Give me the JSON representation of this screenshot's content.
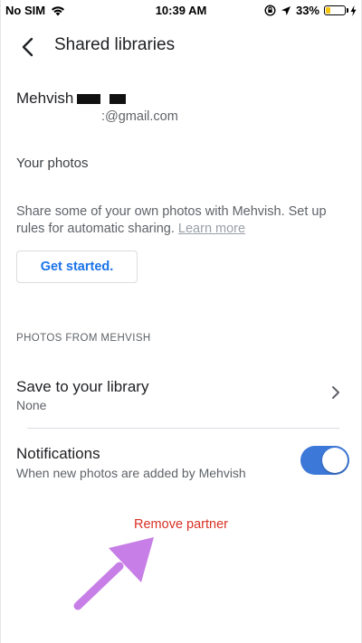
{
  "status_bar": {
    "carrier": "No SIM",
    "time": "10:39 AM",
    "battery": "33%",
    "battery_level": 0.33,
    "battery_color": "#f6c50f"
  },
  "app_bar": {
    "title": "Shared libraries",
    "back_icon": "back-arrow-icon"
  },
  "account": {
    "name": "Mehvish",
    "email": ":@gmail.com"
  },
  "your_photos": {
    "title": "Your photos",
    "description": "Share some of your own photos with Mehvish. Set up rules for automatic sharing.",
    "learn_more": "Learn more",
    "button": "Get started."
  },
  "photos_from": {
    "header": "PHOTOS FROM MEHVISH",
    "save": {
      "title": "Save to your library",
      "value": "None"
    },
    "notifications": {
      "title": "Notifications",
      "subtitle": "When new photos are added by Mehvish",
      "enabled": true
    }
  },
  "remove_partner": "Remove partner",
  "colors": {
    "accent": "#1a73e8",
    "toggle_on": "#3c78d8",
    "danger": "#d93025",
    "annotation_arrow": "#c77ee6"
  }
}
